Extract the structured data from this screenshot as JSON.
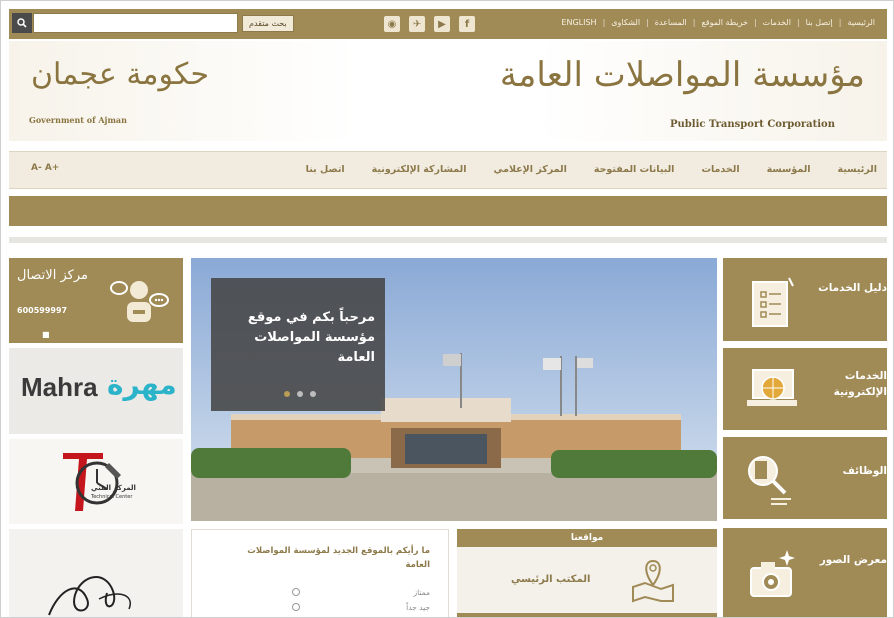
{
  "topbar": {
    "search_placeholder": "",
    "advanced_search": "بحث متقدم",
    "social": [
      {
        "icon": "instagram-icon",
        "glyph": "◉"
      },
      {
        "icon": "twitter-icon",
        "glyph": "✈"
      },
      {
        "icon": "youtube-icon",
        "glyph": "▶"
      },
      {
        "icon": "facebook-icon",
        "glyph": "f"
      }
    ],
    "links": [
      "الرئيسية",
      "إتصل بنا",
      "الخدمات",
      "خريطة الموقع",
      "المساعدة",
      "الشكاوى",
      "ENGLISH"
    ],
    "separator": "|"
  },
  "header": {
    "gov_calligraphy": "حكومة عجمان",
    "gov_english": "Government of Ajman",
    "ptc_calligraphy": "مؤسسة المواصلات العامة",
    "ptc_english": "Public Transport Corporation"
  },
  "nav": {
    "items": [
      "الرئيسية",
      "المؤسسة",
      "الخدمات",
      "البيانات المفتوحة",
      "المركز الإعلامي",
      "المشاركة الإلكترونية",
      "اتصل بنا"
    ],
    "font_controls": "A- A+"
  },
  "left_column": {
    "contact_title": "مركز الاتصال",
    "contact_phone": "600599997",
    "contact_mark": "■",
    "mahra_latin": "Mahra",
    "mahra_arabic": "مهرة",
    "tech_arabic": "المركز الفني",
    "tech_english": "Technical Center"
  },
  "slider": {
    "caption": "مرحباً بكم في موقع مؤسسة المواصلات العامة",
    "dots": 3,
    "active_dot": 1
  },
  "poll": {
    "question": "ما رأيكم بالموقع الجديد لمؤسسة المواصلات العامة",
    "options": [
      "ممتاز",
      "جيد جداً"
    ]
  },
  "locations": {
    "title": "مواقعنا",
    "office": "المكتب الرئيسي"
  },
  "right_tiles": {
    "guide": "دليل الخدمات",
    "eservices": "الخدمات الإلكترونية",
    "jobs": "الوظائف",
    "gallery": "معرض الصور"
  },
  "colors": {
    "gold": "#a08a55",
    "nav_bg": "#f1ebe0",
    "mahra_teal": "#2bb3c9",
    "caption_bg": "#464646"
  }
}
